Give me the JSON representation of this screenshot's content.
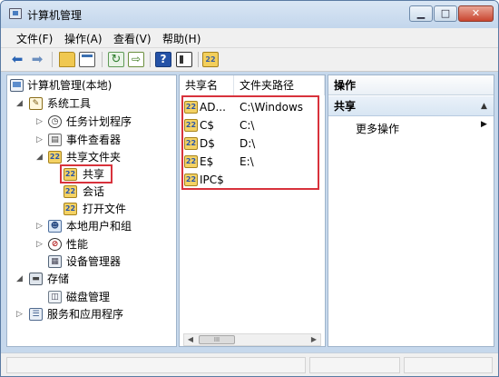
{
  "window": {
    "title": "计算机管理",
    "minimize_glyph": "▁",
    "maximize_glyph": "□",
    "close_glyph": "✕"
  },
  "menu": [
    "文件(F)",
    "操作(A)",
    "查看(V)",
    "帮助(H)"
  ],
  "toolbar": {
    "back_glyph": "⬅",
    "forward_glyph": "➡",
    "refresh_glyph": "↻",
    "export_glyph": "⇨",
    "help_glyph": "?",
    "share_glyph": "22"
  },
  "tree": {
    "root": "计算机管理(本地)",
    "system_tools": "系统工具",
    "task_scheduler": "任务计划程序",
    "event_viewer": "事件查看器",
    "shared_folders": "共享文件夹",
    "shares": "共享",
    "sessions": "会话",
    "open_files": "打开文件",
    "local_users": "本地用户和组",
    "performance": "性能",
    "device_manager": "设备管理器",
    "storage": "存储",
    "disk_management": "磁盘管理",
    "services_apps": "服务和应用程序"
  },
  "tree_icon_glyphs": {
    "tools": "✎",
    "clock": "◷",
    "event": "▤",
    "share": "22",
    "users": "☻",
    "perf": "⊘",
    "device": "▦",
    "storage": "▬",
    "disk": "◫",
    "services": "☰"
  },
  "list": {
    "col_name": "共享名",
    "col_path": "文件夹路径",
    "rows": [
      {
        "name": "AD...",
        "path": "C:\\Windows"
      },
      {
        "name": "C$",
        "path": "C:\\"
      },
      {
        "name": "D$",
        "path": "D:\\"
      },
      {
        "name": "E$",
        "path": "E:\\"
      },
      {
        "name": "IPC$",
        "path": ""
      }
    ],
    "scroll_left": "◀",
    "scroll_right": "▶",
    "scroll_thumb": "III"
  },
  "actions": {
    "header": "操作",
    "section": "共享",
    "section_glyph": "▲",
    "more": "更多操作",
    "more_glyph": "▶"
  },
  "colors": {
    "highlight_border": "#d8323c"
  }
}
